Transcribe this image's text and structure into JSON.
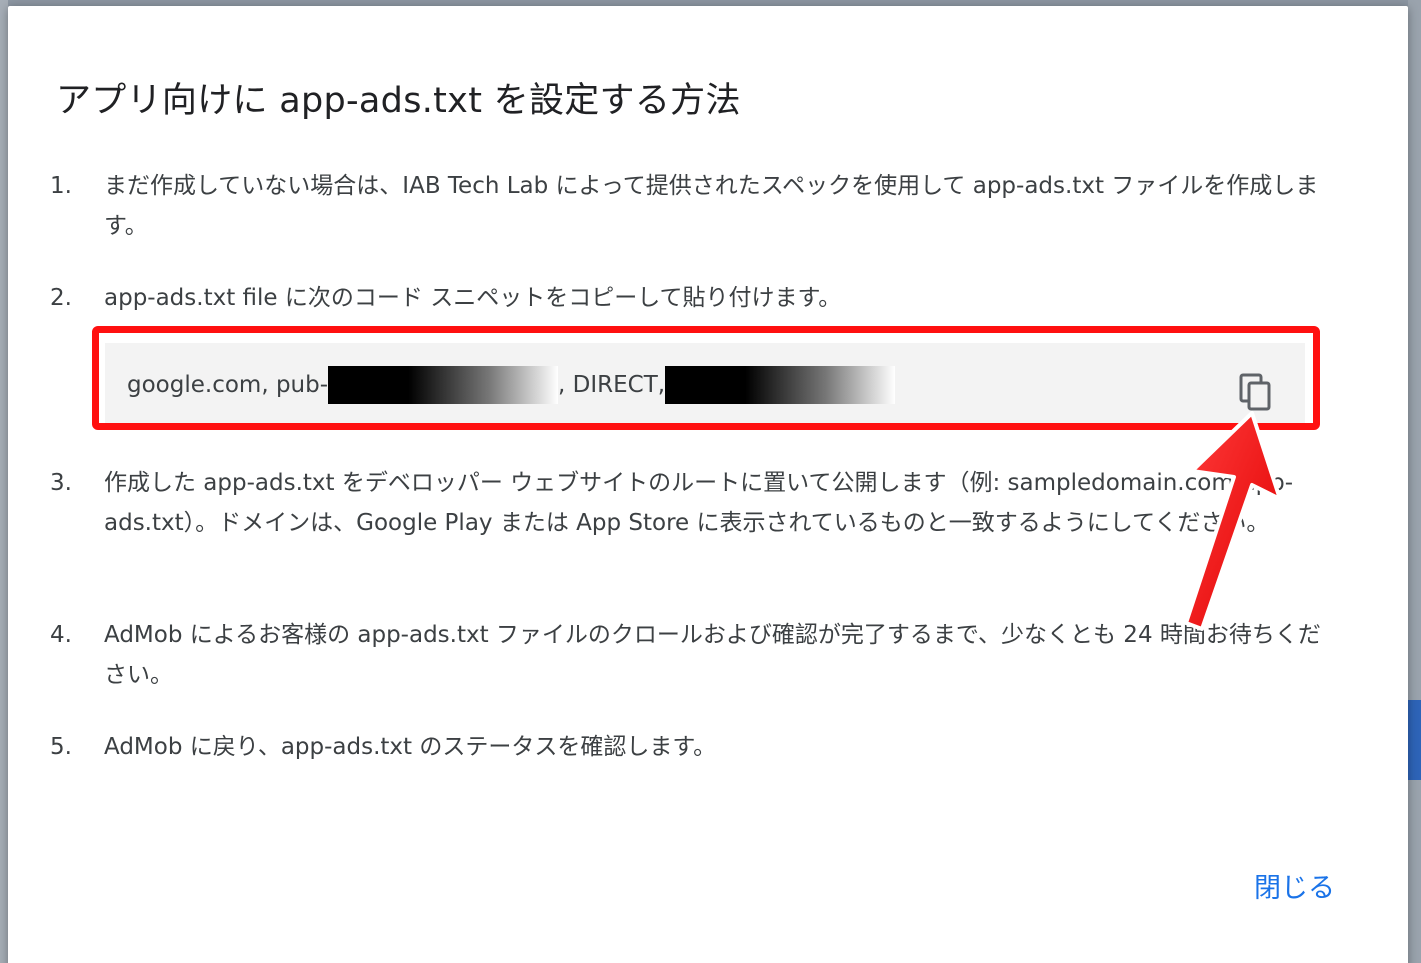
{
  "dialog": {
    "title": "アプリ向けに app-ads.txt を設定する方法",
    "steps": [
      {
        "number": "1.",
        "text": "まだ作成していない場合は、IAB Tech Lab によって提供されたスペックを使用して app-ads.txt ファイルを作成します。"
      },
      {
        "number": "2.",
        "text": "app-ads.txt file に次のコード スニペットをコピーして貼り付けます。"
      },
      {
        "number": "3.",
        "text": "作成した app-ads.txt をデベロッパー ウェブサイトのルートに置いて公開します（例: sampledomain.com/app-ads.txt）。ドメインは、Google Play または App Store に表示されているものと一致するようにしてください。"
      },
      {
        "number": "4.",
        "text": "AdMob によるお客様の app-ads.txt ファイルのクロールおよび確認が完了するまで、少なくとも 24 時間お待ちください。"
      },
      {
        "number": "5.",
        "text": "AdMob に戻り、app-ads.txt のステータスを確認します。"
      }
    ],
    "snippet": {
      "part1": "google.com, pub-",
      "part2": ", DIRECT, "
    },
    "close_label": "閉じる"
  },
  "colors": {
    "highlight": "#ff1010",
    "accent": "#1a73e8"
  },
  "icons": {
    "copy": "copy-icon",
    "annotation": "red-arrow-icon"
  }
}
